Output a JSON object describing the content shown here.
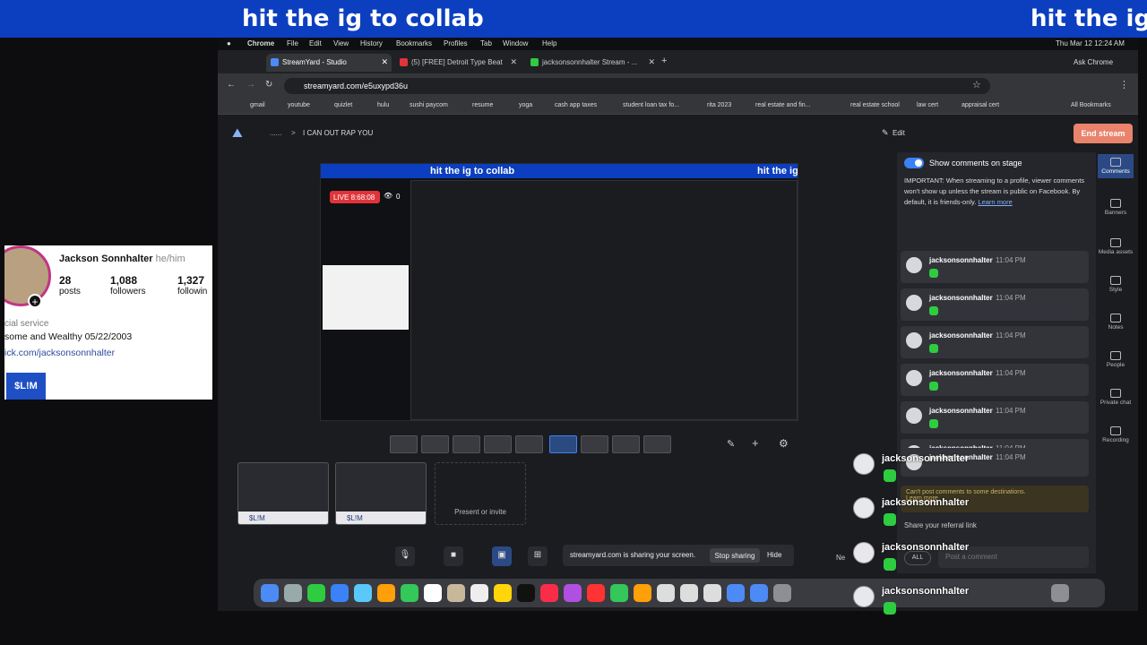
{
  "banner": {
    "text_1": "hit the ig to collab",
    "text_2": "hit the ig t"
  },
  "mac_menubar": {
    "app": "Chrome",
    "menus": [
      "File",
      "Edit",
      "View",
      "History",
      "Bookmarks",
      "Profiles",
      "Tab",
      "Window",
      "Help"
    ],
    "datetime": "Thu Mar 12  12:24 AM"
  },
  "browser": {
    "tabs": [
      {
        "label": "StreamYard - Studio",
        "color": "#4c8bf5"
      },
      {
        "label": "(5) [FREE] Detroit Type Beat",
        "color": "#e0343a"
      },
      {
        "label": "jacksonsonnhalter Stream - ...",
        "color": "#2ecc40"
      }
    ],
    "url": "streamyard.com/e5uxypd36u",
    "ask": "Ask Chrome",
    "bookmarks": [
      "gmail",
      "youtube",
      "quizlet",
      "hulu",
      "sushi paycom",
      "resume",
      "yoga",
      "cash app taxes",
      "student loan tax fo...",
      "rita 2023",
      "real estate and fin...",
      "real estate school",
      "law cert",
      "appraisal cert"
    ],
    "all_bookmarks": "All Bookmarks"
  },
  "studio": {
    "breadcrumb_root": "......",
    "breadcrumb_sep": ">",
    "breadcrumb_title": "I CAN OUT RAP YOU",
    "edit_label": "Edit",
    "end_stream": "End stream",
    "stage_banner_1": "hit the ig to collab",
    "stage_banner_2": "hit the ig",
    "live_label": "LIVE 8:68:08",
    "viewers": "0",
    "thumb_label": "$L!M",
    "present_label": "Present or invite",
    "sharing_text": "streamyard.com is sharing your screen.",
    "stop_sharing": "Stop sharing",
    "hide": "Hide",
    "new_label": "Ne"
  },
  "comments_panel": {
    "title": "Show comments on stage",
    "important": "IMPORTANT: When streaming to a profile, viewer comments won't show up unless the stream is public on Facebook. By default, it is friends-only.",
    "learn_more": "Learn more",
    "comments": [
      {
        "name": "jacksonsonnhalter",
        "time": "11:04 PM"
      },
      {
        "name": "jacksonsonnhalter",
        "time": "11:04 PM"
      },
      {
        "name": "jacksonsonnhalter",
        "time": "11:04 PM"
      },
      {
        "name": "jacksonsonnhalter",
        "time": "11:04 PM"
      },
      {
        "name": "jacksonsonnhalter",
        "time": "11:04 PM"
      },
      {
        "name": "jacksonsonnhalter",
        "time": "11:04 PM"
      },
      {
        "name": "jacksonsonnhalter",
        "time": "11:04 PM"
      }
    ],
    "cant_post": "Can't post comments to some destinations.",
    "cant_learn": "Learn more",
    "referral": "Share your referral link",
    "all_label": "ALL",
    "post_placeholder": "Post a comment"
  },
  "rail": [
    "Comments",
    "Banners",
    "Media assets",
    "Style",
    "Notes",
    "People",
    "Private chat",
    "Recording"
  ],
  "profile": {
    "name": "Jackson Sonnhalter",
    "pronouns": "he/him",
    "posts_count": "28",
    "posts_label": "posts",
    "followers_count": "1,088",
    "followers_label": "followers",
    "following_count": "1,327",
    "following_label": "followin",
    "category": "cial service",
    "bio": "some and Wealthy 05/22/2003",
    "link": "ick.com/jacksonsonnhalter",
    "button": "$L!M",
    "plus": "+"
  },
  "overlay_comments": [
    {
      "name": "jacksonsonnhalter"
    },
    {
      "name": "jacksonsonnhalter"
    },
    {
      "name": "jacksonsonnhalter"
    },
    {
      "name": "jacksonsonnhalter"
    }
  ]
}
